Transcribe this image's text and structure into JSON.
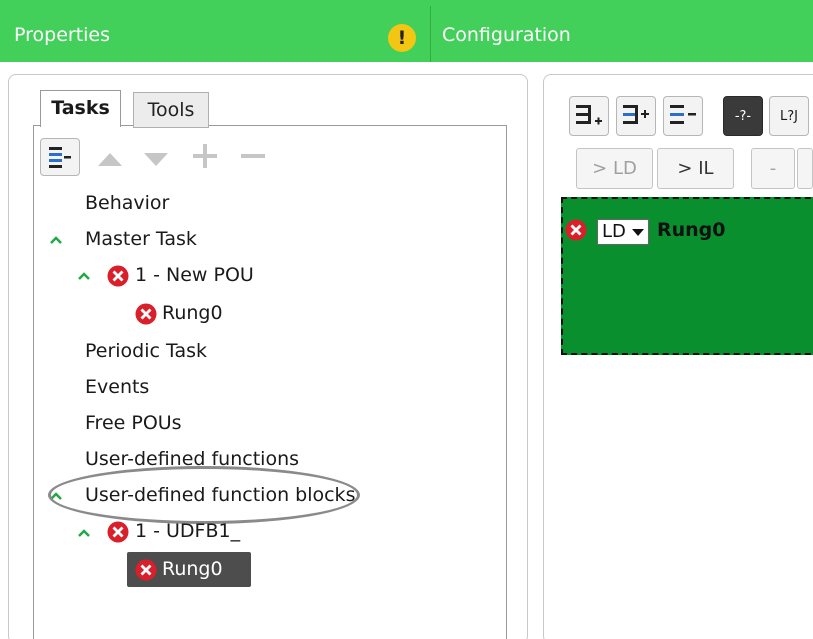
{
  "header": {
    "properties_label": "Properties",
    "warning_symbol": "!",
    "configuration_label": "Configuration",
    "accent_color": "#43d05a"
  },
  "left_panel": {
    "tabs": [
      {
        "label": "Tasks",
        "selected": true
      },
      {
        "label": "Tools",
        "selected": false
      }
    ],
    "toolbar": {
      "icons": [
        "collapse-all-icon",
        "move-up-icon",
        "move-down-icon",
        "add-icon",
        "remove-icon"
      ]
    },
    "tree": {
      "behavior": "Behavior",
      "master_task": "Master Task",
      "new_pou": "1 - New POU",
      "rung0_a": "Rung0",
      "periodic_task": "Periodic Task",
      "events": "Events",
      "free_pous": "Free POUs",
      "udf": "User-defined functions",
      "udfb": "User-defined function blocks",
      "udfb1": "1 - UDFB1_",
      "rung0_b": "Rung0"
    }
  },
  "right_panel": {
    "toolbar": {
      "dark_btn_label": "-?-",
      "coil_btn_label": "L?J"
    },
    "convert": {
      "to_ld": "> LD",
      "to_il": "> IL",
      "dash": "-"
    },
    "rung": {
      "language": "LD",
      "title": "Rung0",
      "background": "#0a8f2f"
    }
  }
}
